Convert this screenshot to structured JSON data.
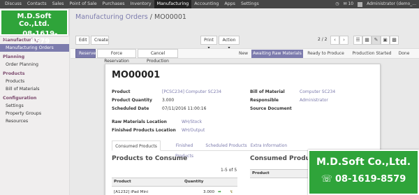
{
  "topbar": {
    "menu": [
      "Discuss",
      "Contacts",
      "Sales",
      "Point of Sale",
      "Purchases",
      "Inventory",
      "Manufacturing",
      "Accounting",
      "Apps",
      "Settings"
    ],
    "active": "Manufacturing",
    "messages_count": "10",
    "user": "Administrator (demo_..."
  },
  "logo": {
    "name": "M.D.Soft Co.,Ltd.",
    "phone": "08-1619-8579"
  },
  "sidebar": {
    "sections": [
      {
        "title": "Manufacturing",
        "items": [
          "Manufacturing Orders"
        ]
      },
      {
        "title": "Planning",
        "items": [
          "Order Planning"
        ]
      },
      {
        "title": "Products",
        "items": [
          "Products",
          "Bill of Materials"
        ]
      },
      {
        "title": "Configuration",
        "items": [
          "Settings",
          "Property Groups",
          "Resources"
        ]
      }
    ],
    "active_item": "Manufacturing Orders"
  },
  "breadcrumb": {
    "parent": "Manufacturing Orders",
    "sep": "/",
    "current": "MO00001"
  },
  "toolbar": {
    "edit": "Edit",
    "create": "Create",
    "print": "Print ▾",
    "action": "Action ▾",
    "pager": "2 / 2"
  },
  "statusbar": {
    "buttons": [
      "Reserve",
      "Force Reservation",
      "Cancel Production"
    ],
    "stages": [
      "New",
      "Awaiting Raw Materials",
      "Ready to Produce",
      "Production Started",
      "Done"
    ],
    "active_stage": "Awaiting Raw Materials"
  },
  "form": {
    "name": "MO00001",
    "left_fields": [
      {
        "label": "Product",
        "value": "[PCSC234] Computer SC234",
        "link": true
      },
      {
        "label": "Product Quantity",
        "value": "3.000",
        "link": false
      },
      {
        "label": "Scheduled Date",
        "value": "07/11/2016 11:00:16",
        "link": false
      }
    ],
    "right_fields": [
      {
        "label": "Bill of Material",
        "value": "Computer SC234",
        "link": true
      },
      {
        "label": "Responsible",
        "value": "Administrator",
        "link": true
      },
      {
        "label": "Source Document",
        "value": "",
        "link": false
      }
    ],
    "location_fields": [
      {
        "label": "Raw Materials Location",
        "value": "WH/Stock"
      },
      {
        "label": "Finished Products Location",
        "value": "WH/Output"
      }
    ],
    "tabs": [
      "Consumed Products",
      "Finished Products",
      "Scheduled Products",
      "Extra Information"
    ],
    "active_tab": "Consumed Products",
    "to_consume_title": "Products to Consume",
    "to_consume_pager": "1-5 of 5",
    "to_consume_columns": [
      "Product",
      "Quantity"
    ],
    "to_consume_rows": [
      {
        "product": "[A1232] iPad Mini",
        "quantity": "3.000"
      }
    ],
    "consumed_title": "Consumed Products",
    "consumed_columns": [
      "Product"
    ]
  },
  "colors": {
    "accent": "#7c7bad",
    "logo_green": "#2fa43a",
    "topbar": "#464646"
  }
}
